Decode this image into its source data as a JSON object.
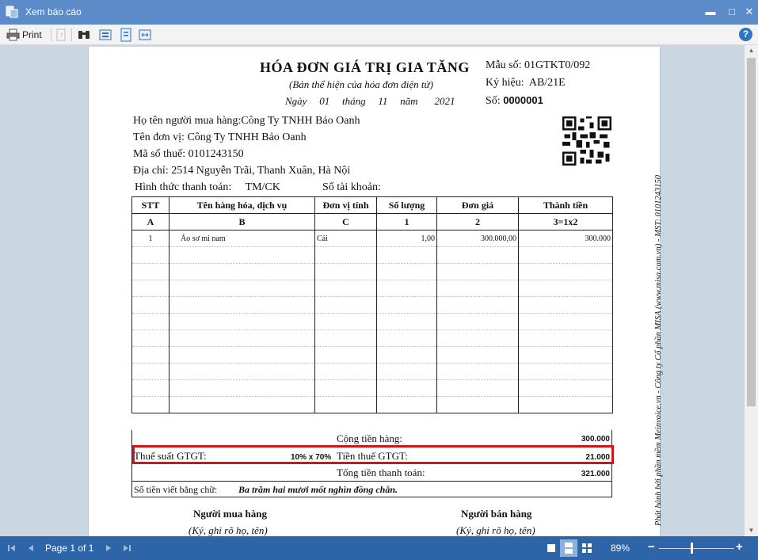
{
  "window": {
    "title": "Xem báo cáo",
    "minimize": "▬",
    "maximize": "□",
    "close": "✕"
  },
  "toolbar": {
    "print_label": "Print",
    "help_label": "?"
  },
  "invoice": {
    "title": "HÓA ĐƠN GIÁ TRỊ GIA TĂNG",
    "subtitle": "(Bản thể hiện của hóa đơn điện tử)",
    "date": {
      "day_label": "Ngày",
      "day": "01",
      "month_label": "tháng",
      "month": "11",
      "year_label": "năm",
      "year": "2021"
    },
    "template_label": "Mẫu số:",
    "template_value": "01GTKT0/092",
    "series_label": "Ký hiệu:",
    "series_value": "AB/21E",
    "number_label": "Số:",
    "number_value": "0000001",
    "buyer_name": "Họ tên người mua hàng:Công Ty TNHH Bảo Oanh",
    "unit_name": "Tên đơn vị: Công Ty TNHH Bảo Oanh",
    "tax_code": "Mã số thuế: 0101243150",
    "address": "Địa chỉ: 2514 Nguyễn Trãi, Thanh Xuân, Hà Nội",
    "payment_label": "Hình thức thanh toán:",
    "payment_value": "TM/CK",
    "account_label": "Số tài khoản:",
    "columns": [
      "STT",
      "Tên hàng hóa, dịch vụ",
      "Đơn vị tính",
      "Số lượng",
      "Đơn giá",
      "Thành tiền"
    ],
    "column_codes": [
      "A",
      "B",
      "C",
      "1",
      "2",
      "3=1x2"
    ],
    "items": [
      {
        "stt": "1",
        "name": "Áo sơ mi nam",
        "unit": "Cái",
        "qty": "1,00",
        "price": "300.000,00",
        "amount": "300.000"
      }
    ],
    "subtotal_label": "Cộng tiền hàng:",
    "subtotal_value": "300.000",
    "vat_rate_label": "Thuế suất GTGT:",
    "vat_rate_value": "10% x 70%",
    "vat_amount_label": "Tiền thuế GTGT:",
    "vat_amount_value": "21.000",
    "total_label": "Tổng tiền thanh toán:",
    "total_value": "321.000",
    "words_label": "Số tiền viết bằng chữ:",
    "words_value": "Ba trăm hai mươi mốt nghìn đồng chẵn.",
    "buyer_sign": "Người mua hàng",
    "buyer_sign_note": "(Ký, ghi rõ họ, tên)",
    "seller_sign": "Người bán hàng",
    "seller_sign_note": "(Ký, ghi rõ họ, tên)",
    "side_note": "Phát hành bởi phần mềm Meinvoice.vn - Công ty Cổ phần MISA (www.misa.com.vn) - MST: 0101243150"
  },
  "statusbar": {
    "page_label": "Page 1 of 1",
    "zoom_label": "89%",
    "zoom_minus": "−",
    "zoom_plus": "+"
  },
  "colors": {
    "titlebar": "#5b8bc8",
    "statusbar": "#2e64a8",
    "highlight_box": "#d0161c"
  }
}
